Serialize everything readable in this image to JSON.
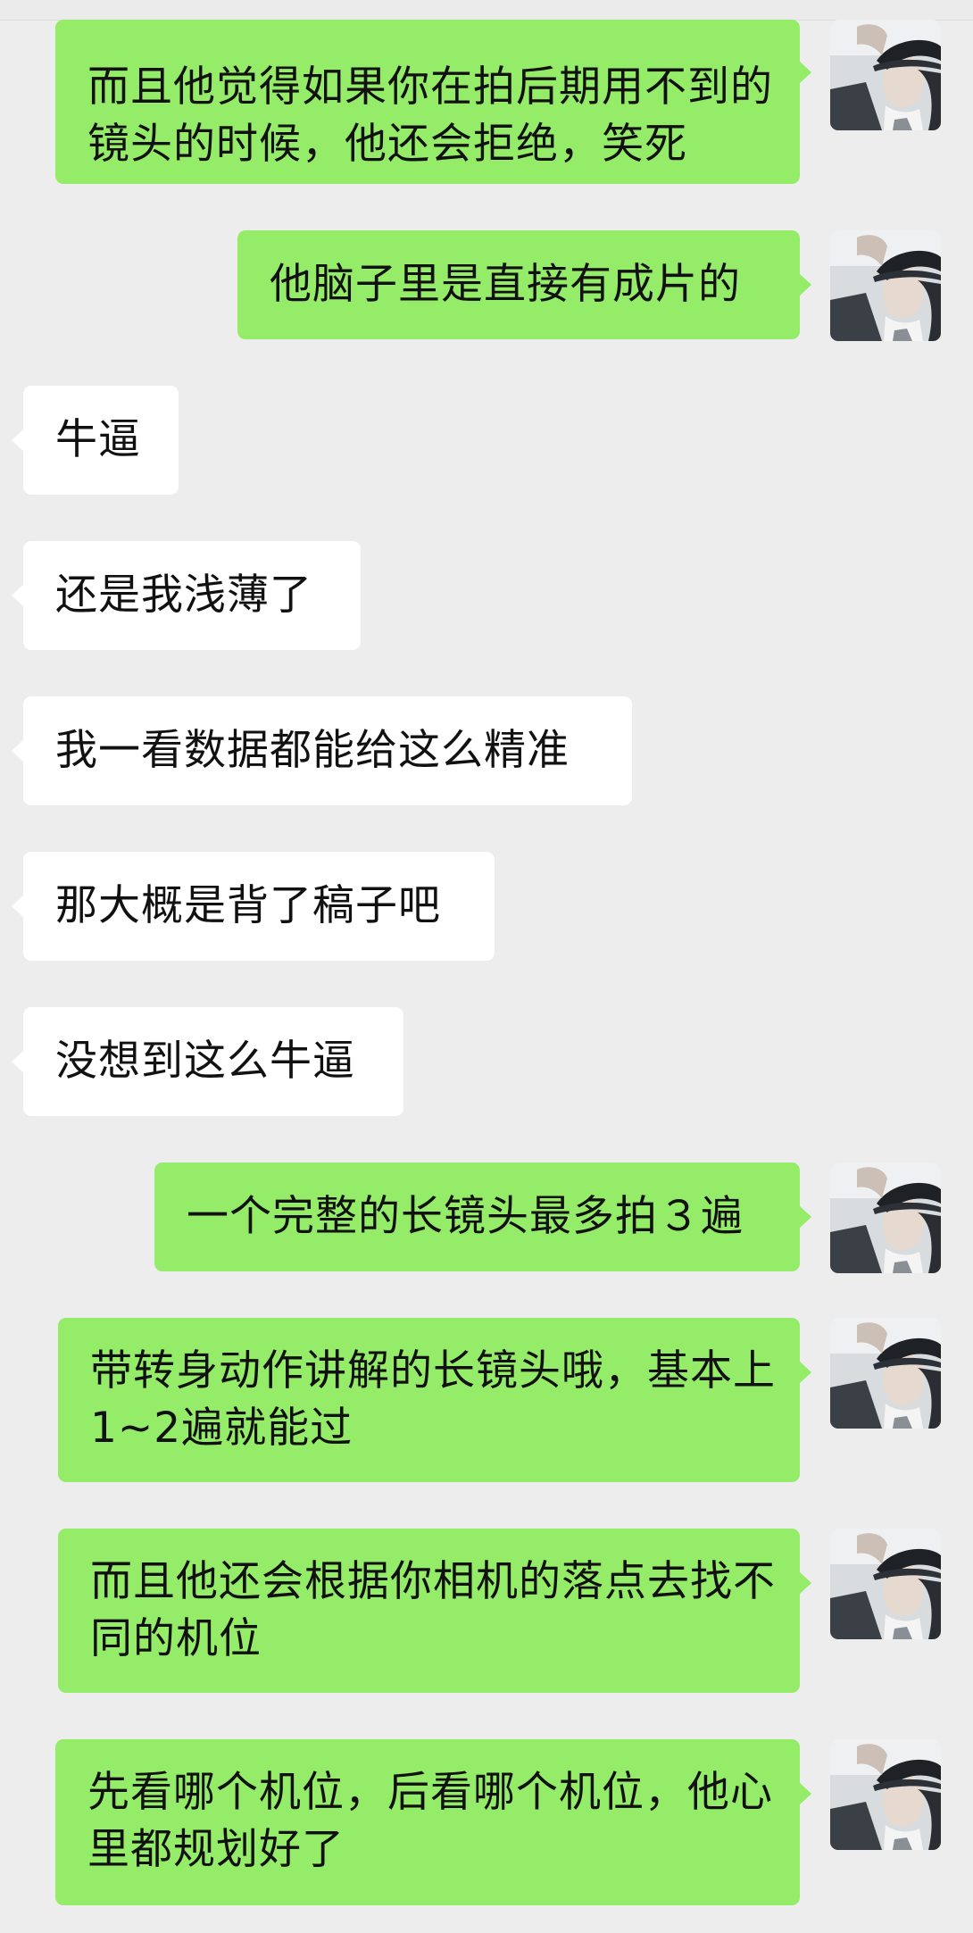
{
  "chat": {
    "messages": [
      {
        "from": "me",
        "text": "而且他觉得如果你在拍后期用不到的镜头的时候，他还会拒绝，笑死"
      },
      {
        "from": "me",
        "text": "他脑子里是直接有成片的"
      },
      {
        "from": "them",
        "text": "牛逼"
      },
      {
        "from": "them",
        "text": "还是我浅薄了"
      },
      {
        "from": "them",
        "text": "我一看数据都能给这么精准"
      },
      {
        "from": "them",
        "text": "那大概是背了稿子吧"
      },
      {
        "from": "them",
        "text": "没想到这么牛逼"
      },
      {
        "from": "me",
        "text": "一个完整的长镜头最多拍３遍"
      },
      {
        "from": "me",
        "text": "带转身动作讲解的长镜头哦，基本上1~2遍就能过"
      },
      {
        "from": "me",
        "text": "而且他还会根据你相机的落点去找不同的机位"
      },
      {
        "from": "me",
        "text": "先看哪个机位，后看哪个机位，他心里都规划好了"
      }
    ]
  },
  "colors": {
    "background": "#ededed",
    "outgoing_bubble": "#95ec69",
    "incoming_bubble": "#ffffff",
    "text": "#111111"
  },
  "icons": {
    "avatar": "user-avatar-photo"
  }
}
